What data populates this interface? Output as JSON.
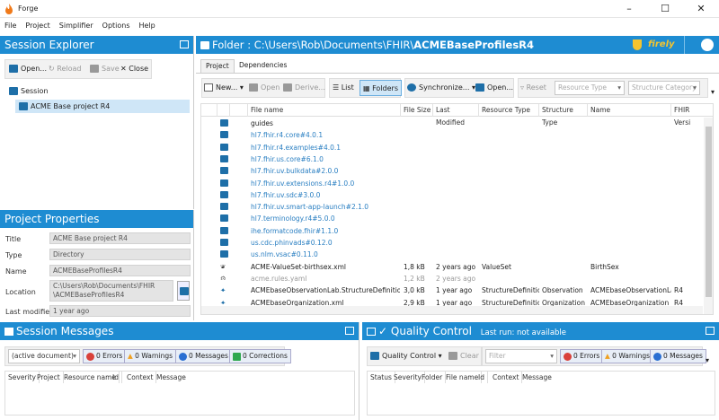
{
  "window": {
    "title": "Forge"
  },
  "menu": [
    "File",
    "Project",
    "Simplifier",
    "Options",
    "Help"
  ],
  "session_explorer": {
    "title": "Session Explorer",
    "toolbar": {
      "open": "Open...",
      "reload": "Reload",
      "save": "Save",
      "close": "Close"
    },
    "tree": {
      "root": "Session",
      "child": "ACME Base project R4"
    }
  },
  "project_properties": {
    "title": "Project Properties",
    "fields": [
      {
        "label": "Title",
        "value": "ACME Base project R4"
      },
      {
        "label": "Type",
        "value": "Directory"
      },
      {
        "label": "Name",
        "value": "ACMEBaseProfilesR4"
      },
      {
        "label": "Location",
        "value_line1": "C:\\Users\\Rob\\Documents\\FHIR",
        "value_line2": "\\ACMEBaseProfilesR4"
      },
      {
        "label": "Last modified",
        "value": "1 year ago"
      }
    ]
  },
  "folder": {
    "prefix": "Folder : ",
    "path": "C:\\Users\\Rob\\Documents\\FHIR\\",
    "name": "ACMEBaseProfilesR4",
    "brand": "firely",
    "tabs": [
      "Project",
      "Dependencies"
    ],
    "toolbar": {
      "new": "New...",
      "open": "Open",
      "derive": "Derive...",
      "list": "List",
      "folders": "Folders",
      "synchronize": "Synchronize...",
      "open2": "Open...",
      "reset": "Reset",
      "resource_type_placeholder": "Resource Type",
      "structure_category_placeholder": "Structure Category"
    },
    "columns": [
      "File name",
      "File Size",
      "Last Modified",
      "Resource Type",
      "Structure Type",
      "Name",
      "FHIR Versi"
    ],
    "rows": [
      {
        "kind": "folder",
        "name": "guides",
        "size": "",
        "modified": "",
        "rtype": "",
        "stype": "",
        "rname": "",
        "fhir": "",
        "style": "plain"
      },
      {
        "kind": "folder",
        "name": "hl7.fhir.r4.core#4.0.1",
        "size": "",
        "modified": "",
        "rtype": "",
        "stype": "",
        "rname": "",
        "fhir": "",
        "style": "link"
      },
      {
        "kind": "folder",
        "name": "hl7.fhir.r4.examples#4.0.1",
        "size": "",
        "modified": "",
        "rtype": "",
        "stype": "",
        "rname": "",
        "fhir": "",
        "style": "link"
      },
      {
        "kind": "folder",
        "name": "hl7.fhir.us.core#6.1.0",
        "size": "",
        "modified": "",
        "rtype": "",
        "stype": "",
        "rname": "",
        "fhir": "",
        "style": "link"
      },
      {
        "kind": "folder",
        "name": "hl7.fhir.uv.bulkdata#2.0.0",
        "size": "",
        "modified": "",
        "rtype": "",
        "stype": "",
        "rname": "",
        "fhir": "",
        "style": "link"
      },
      {
        "kind": "folder",
        "name": "hl7.fhir.uv.extensions.r4#1.0.0",
        "size": "",
        "modified": "",
        "rtype": "",
        "stype": "",
        "rname": "",
        "fhir": "",
        "style": "link"
      },
      {
        "kind": "folder",
        "name": "hl7.fhir.uv.sdc#3.0.0",
        "size": "",
        "modified": "",
        "rtype": "",
        "stype": "",
        "rname": "",
        "fhir": "",
        "style": "link"
      },
      {
        "kind": "folder",
        "name": "hl7.fhir.uv.smart-app-launch#2.1.0",
        "size": "",
        "modified": "",
        "rtype": "",
        "stype": "",
        "rname": "",
        "fhir": "",
        "style": "link"
      },
      {
        "kind": "folder",
        "name": "hl7.terminology.r4#5.0.0",
        "size": "",
        "modified": "",
        "rtype": "",
        "stype": "",
        "rname": "",
        "fhir": "",
        "style": "link"
      },
      {
        "kind": "folder",
        "name": "ihe.formatcode.fhir#1.1.0",
        "size": "",
        "modified": "",
        "rtype": "",
        "stype": "",
        "rname": "",
        "fhir": "",
        "style": "link"
      },
      {
        "kind": "folder",
        "name": "us.cdc.phinvads#0.12.0",
        "size": "",
        "modified": "",
        "rtype": "",
        "stype": "",
        "rname": "",
        "fhir": "",
        "style": "link"
      },
      {
        "kind": "folder",
        "name": "us.nlm.vsac#0.11.0",
        "size": "",
        "modified": "",
        "rtype": "",
        "stype": "",
        "rname": "",
        "fhir": "",
        "style": "link"
      },
      {
        "kind": "flame",
        "name": "ACME-ValueSet-birthsex.xml",
        "size": "1,8 kB",
        "modified": "2 years ago",
        "rtype": "ValueSet",
        "stype": "",
        "rname": "BirthSex",
        "fhir": "",
        "style": "plain"
      },
      {
        "kind": "gear",
        "name": "acme.rules.yaml",
        "size": "1,2 kB",
        "modified": "2 years ago",
        "rtype": "",
        "stype": "",
        "rname": "",
        "fhir": "",
        "style": "faded"
      },
      {
        "kind": "puzzle",
        "name": "ACMEbaseObservationLab.StructureDefinition.xml",
        "size": "3,0 kB",
        "modified": "1 year ago",
        "rtype": "StructureDefinition",
        "stype": "Observation",
        "rname": "ACMEbaseObservationLab",
        "fhir": "R4",
        "style": "plain"
      },
      {
        "kind": "puzzle",
        "name": "ACMEbaseOrganization.xml",
        "size": "2,9 kB",
        "modified": "1 year ago",
        "rtype": "StructureDefinition",
        "stype": "Organization",
        "rname": "ACMEbaseOrganization",
        "fhir": "R4",
        "style": "plain"
      }
    ]
  },
  "session_messages": {
    "title": "Session Messages",
    "select": "(active document)",
    "errors": "0 Errors",
    "warnings": "0 Warnings",
    "messages": "0 Messages",
    "corrections": "0 Corrections",
    "columns": [
      "Severity",
      "Project",
      "Resource name",
      "Id",
      "Context",
      "Message"
    ]
  },
  "quality_control": {
    "title": "Quality Control",
    "last_run": "Last run: not available",
    "qc_button": "Quality Control",
    "clear": "Clear",
    "filter_placeholder": "Filter",
    "errors": "0 Errors",
    "warnings": "0 Warnings",
    "messages": "0 Messages",
    "columns": [
      "Status",
      "Severity",
      "Folder",
      "File name",
      "Id",
      "Context",
      "Message"
    ]
  },
  "colors": {
    "accent": "#1e8cd2",
    "link": "#2a7fc2",
    "folder": "#1e6fa8",
    "error": "#d9413a",
    "warning": "#f0a020",
    "info": "#2a6fd2",
    "ok": "#2fa84f"
  }
}
